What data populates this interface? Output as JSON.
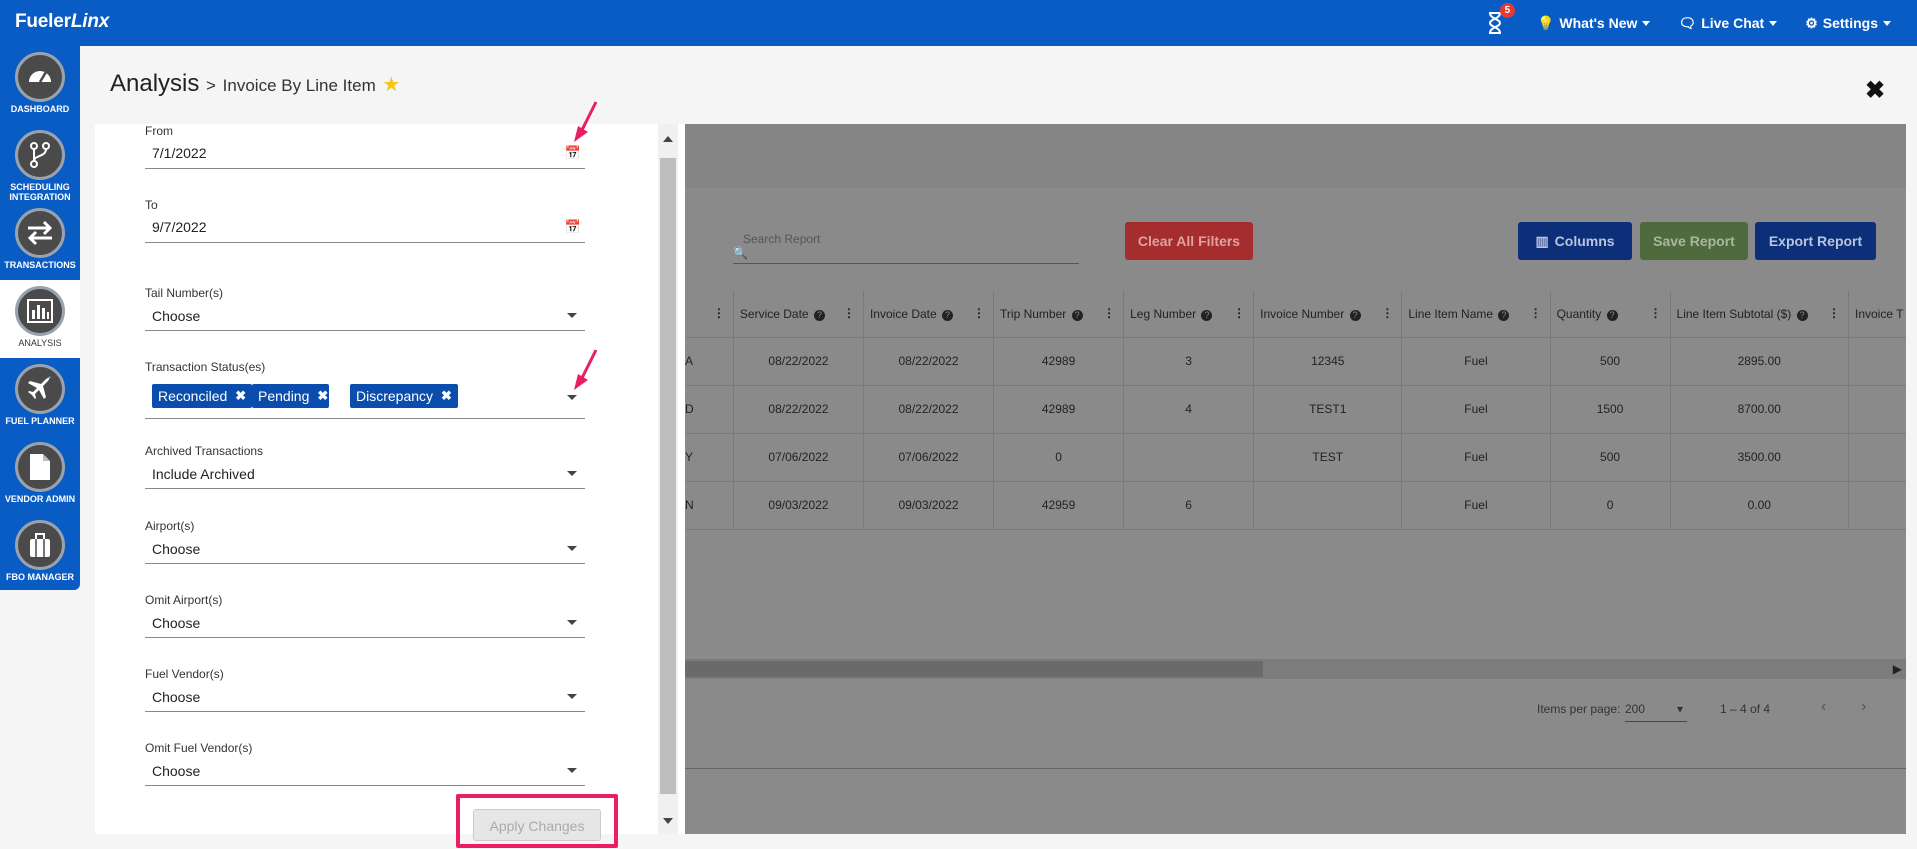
{
  "topbar": {
    "brand_main": "Fueler",
    "brand_italic": "Linx",
    "notif_count": "5",
    "whats_new": "What's New",
    "live_chat": "Live Chat",
    "settings": "Settings"
  },
  "sidebar": {
    "items": [
      {
        "label": "DASHBOARD",
        "icon": "speedometer-icon"
      },
      {
        "label": "SCHEDULING INTEGRATION",
        "icon": "branch-icon"
      },
      {
        "label": "TRANSACTIONS",
        "icon": "swap-arrows-icon"
      },
      {
        "label": "ANALYSIS",
        "icon": "bar-chart-icon"
      },
      {
        "label": "FUEL PLANNER",
        "icon": "airplane-icon"
      },
      {
        "label": "VENDOR ADMIN",
        "icon": "document-icon"
      },
      {
        "label": "FBO MANAGER",
        "icon": "briefcase-icon"
      }
    ]
  },
  "header": {
    "title": "Analysis",
    "breadcrumb_sep": ">",
    "subtitle": "Invoice By Line Item"
  },
  "filters": {
    "from_label": "From",
    "from_value": "7/1/2022",
    "to_label": "To",
    "to_value": "9/7/2022",
    "tail_label": "Tail Number(s)",
    "tail_value": "Choose",
    "status_label": "Transaction Status(es)",
    "status_chips": [
      "Reconciled",
      "Pending",
      "Discrepancy"
    ],
    "archived_label": "Archived Transactions",
    "archived_value": "Include Archived",
    "airport_label": "Airport(s)",
    "airport_value": "Choose",
    "omit_airport_label": "Omit Airport(s)",
    "omit_airport_value": "Choose",
    "vendor_label": "Fuel Vendor(s)",
    "vendor_value": "Choose",
    "omit_vendor_label": "Omit Fuel Vendor(s)",
    "omit_vendor_value": "Choose",
    "apply_label": "Apply Changes"
  },
  "report": {
    "search_placeholder": "Search Report",
    "clear_filters": "Clear All Filters",
    "columns": "Columns",
    "save_report": "Save Report",
    "export_report": "Export Report",
    "columns_headers": [
      "",
      "Service Date",
      "Invoice Date",
      "Trip Number",
      "Leg Number",
      "Invoice Number",
      "Line Item Name",
      "Quantity",
      "Line Item Subtotal ($)",
      "Invoice T"
    ],
    "rows": [
      [
        "A",
        "08/22/2022",
        "08/22/2022",
        "42989",
        "3",
        "12345",
        "Fuel",
        "500",
        "2895.00",
        ""
      ],
      [
        "D",
        "08/22/2022",
        "08/22/2022",
        "42989",
        "4",
        "TEST1",
        "Fuel",
        "1500",
        "8700.00",
        ""
      ],
      [
        "Y",
        "07/06/2022",
        "07/06/2022",
        "0",
        "",
        "TEST",
        "Fuel",
        "500",
        "3500.00",
        ""
      ],
      [
        "N",
        "09/03/2022",
        "09/03/2022",
        "42959",
        "6",
        "",
        "Fuel",
        "0",
        "0.00",
        ""
      ]
    ],
    "items_per_page_label": "Items per page:",
    "items_per_page": "200",
    "range": "1 – 4 of 4"
  },
  "colors": {
    "brand_blue": "#0a5cc5",
    "chip_blue": "#0a4dad",
    "highlight_pink": "#e91e63",
    "clear_red": "#c62828",
    "save_green": "#4f7a3a",
    "export_navy": "#0d2f7a"
  }
}
